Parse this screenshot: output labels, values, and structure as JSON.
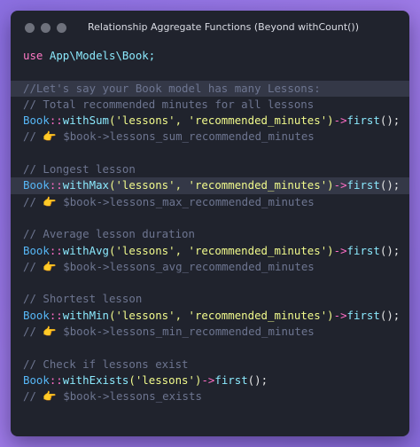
{
  "window": {
    "title": "Relationship Aggregate Functions (Beyond withCount())"
  },
  "code": {
    "use_kw": "use",
    "use_path": "App\\Models\\Book;",
    "comment_intro": "//Let's say your Book model has many Lessons:",
    "sum": {
      "comment": "// Total recommended minutes for all lessons",
      "class": "Book",
      "op": "::",
      "method": "withSum",
      "args": "('lessons', 'recommended_minutes')",
      "arrow": "->",
      "call": "first",
      "tail": "();",
      "result": "// 👉 $book->lessons_sum_recommended_minutes"
    },
    "max": {
      "comment": "// Longest lesson",
      "class": "Book",
      "op": "::",
      "method": "withMax",
      "args": "('lessons', 'recommended_minutes')",
      "arrow": "->",
      "call": "first",
      "tail": "();",
      "result": "// 👉 $book->lessons_max_recommended_minutes"
    },
    "avg": {
      "comment": "// Average lesson duration",
      "class": "Book",
      "op": "::",
      "method": "withAvg",
      "args": "('lessons', 'recommended_minutes')",
      "arrow": "->",
      "call": "first",
      "tail": "();",
      "result": "// 👉 $book->lessons_avg_recommended_minutes"
    },
    "min": {
      "comment": "// Shortest lesson",
      "class": "Book",
      "op": "::",
      "method": "withMin",
      "args": "('lessons', 'recommended_minutes')",
      "arrow": "->",
      "call": "first",
      "tail": "();",
      "result": "// 👉 $book->lessons_min_recommended_minutes"
    },
    "exists": {
      "comment": "// Check if lessons exist",
      "class": "Book",
      "op": "::",
      "method": "withExists",
      "args": "('lessons')",
      "arrow": "->",
      "call": "first",
      "tail": "();",
      "result": "// 👉 $book->lessons_exists"
    }
  },
  "colors": {
    "background": "#9d7ae6",
    "window": "#20232d",
    "highlight_line": "#343847",
    "keyword": "#ff79c6",
    "class": "#56b6f5",
    "string": "#f1fa8c",
    "comment": "#6d7590"
  }
}
